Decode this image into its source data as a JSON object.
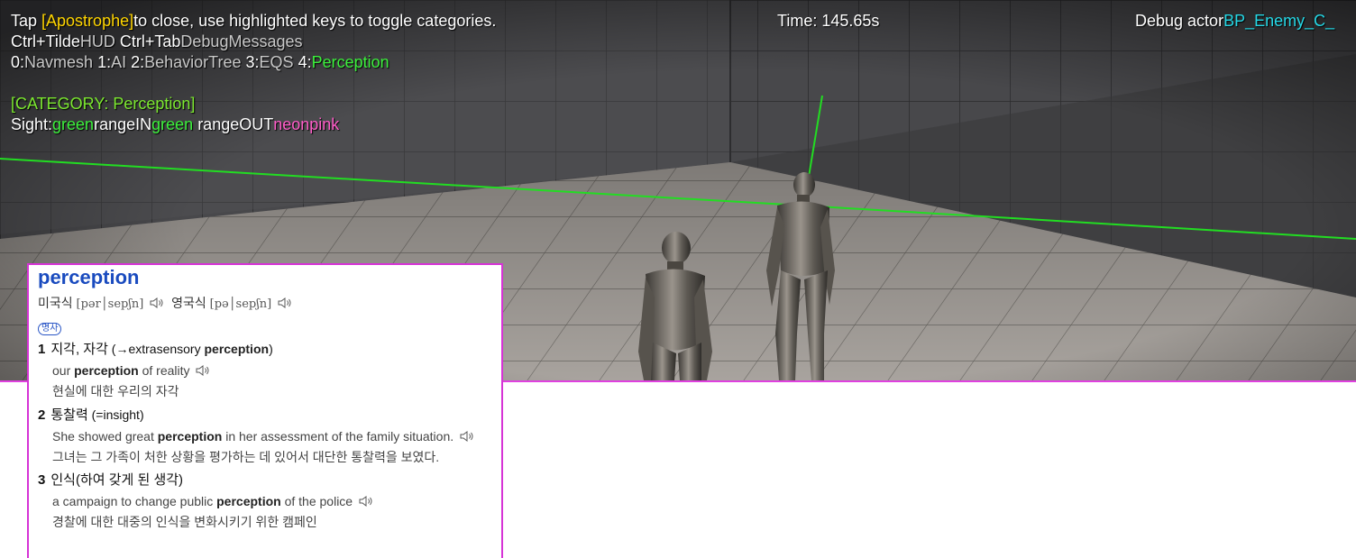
{
  "hud": {
    "line1": {
      "tap": "Tap ",
      "key": "[Apostrophe]",
      "rest": "to close, use highlighted keys to toggle categories."
    },
    "time_label": "Time: 145.65s",
    "debug_actor_label": "Debug actor",
    "debug_actor_name": "BP_Enemy_C_",
    "line2": {
      "key1": "Ctrl+Tilde",
      "name1": "HUD",
      "key2": "Ctrl+Tab",
      "name2": "DebugMessages"
    },
    "line3": {
      "k0": "0:",
      "c0": "Navmesh",
      "k1": "1:",
      "c1": "AI",
      "k2": "2:",
      "c2": "BehaviorTree",
      "k3": "3:",
      "c3": "EQS",
      "k4": "4:",
      "c4": "Perception"
    },
    "category_header": "[CATEGORY: Perception]",
    "sight_line": {
      "sight_label": "Sight:",
      "sight_color": "green",
      "range_in_label": "rangeIN",
      "range_in_color": "green",
      "range_out_label": "rangeOUT",
      "range_out_color": "neonpink"
    }
  },
  "colors": {
    "hud_yellow": "#ffd500",
    "hud_green": "#3cf03c",
    "hud_cyan": "#25d8e6",
    "hud_pink": "#ff5cc8",
    "sight_line": "#22dd22",
    "dict_border": "#d633d6",
    "dict_word": "#1a4bbf"
  },
  "dictionary": {
    "word": "perception",
    "pron": {
      "us_label": "미국식",
      "us_ipa": "[pər│sepʃn]",
      "uk_label": "영국식",
      "uk_ipa": "[pə│sepʃn]",
      "audio_icon": "speaker-icon"
    },
    "pos": "명사",
    "senses": [
      {
        "num": "1",
        "meaning": "지각, 자각",
        "extra_prefix": " (→extrasensory ",
        "extra_bold": "perception",
        "extra_suffix": ")",
        "ex_en_pre": "our ",
        "ex_en_bold": "perception",
        "ex_en_post": " of reality",
        "ex_ko": "현실에 대한 우리의 자각"
      },
      {
        "num": "2",
        "meaning": "통찰력",
        "extra_prefix": " (=insight)",
        "extra_bold": "",
        "extra_suffix": "",
        "ex_en_pre": "She showed great ",
        "ex_en_bold": "perception",
        "ex_en_post": " in her assessment of the family situation.",
        "ex_ko": "그녀는 그 가족이 처한 상황을 평가하는 데 있어서 대단한 통찰력을 보였다."
      },
      {
        "num": "3",
        "meaning": "인식(하여 갖게 된 생각)",
        "extra_prefix": "",
        "extra_bold": "",
        "extra_suffix": "",
        "ex_en_pre": "a campaign to change public ",
        "ex_en_bold": "perception",
        "ex_en_post": " of the police",
        "ex_ko": "경찰에 대한 대중의 인식을 변화시키기 위한 캠페인"
      }
    ]
  }
}
